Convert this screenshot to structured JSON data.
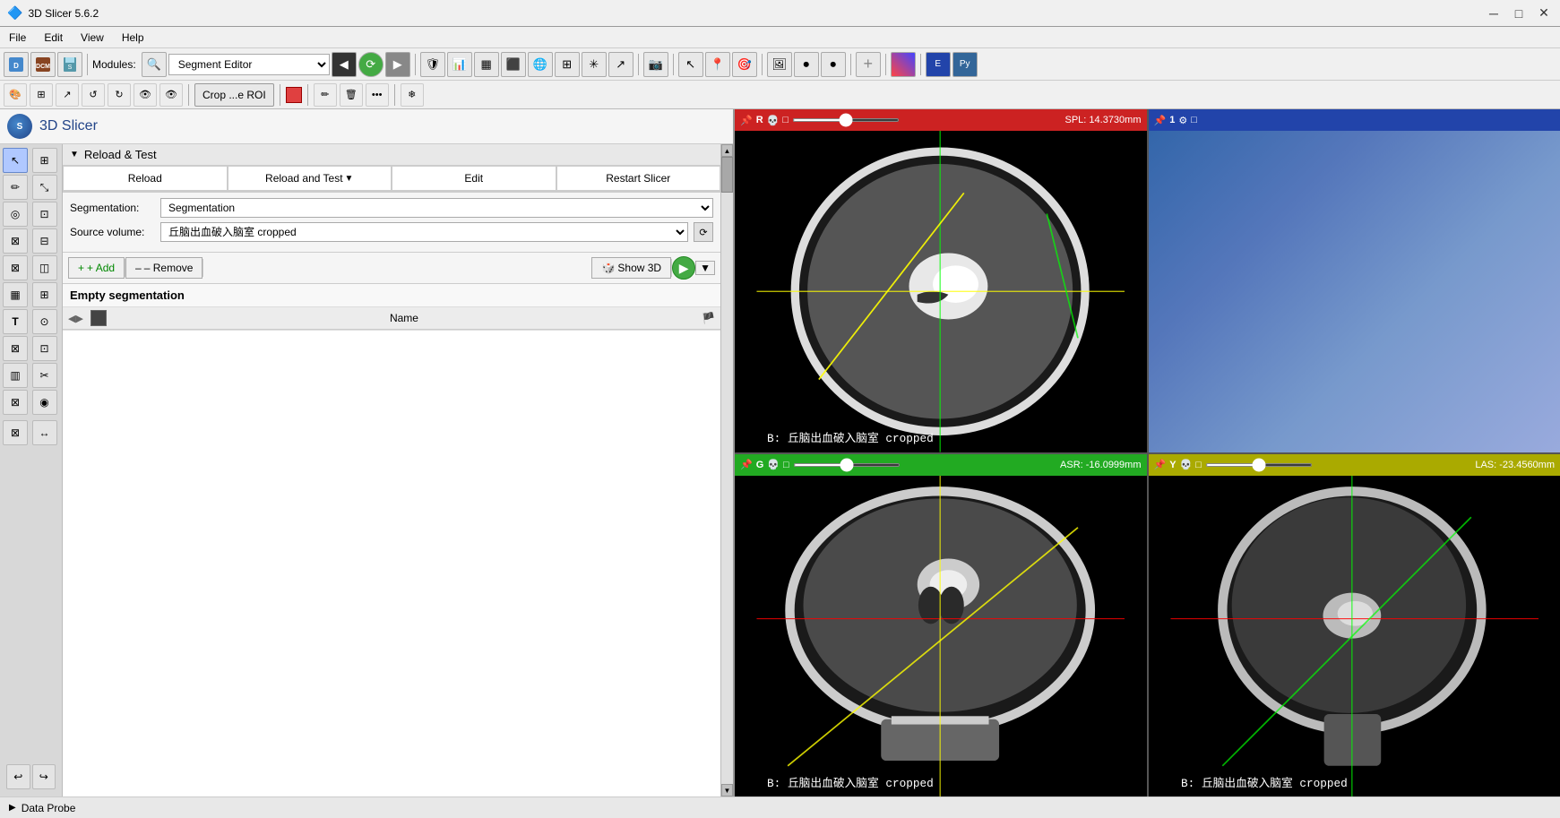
{
  "titleBar": {
    "title": "3D Slicer 5.6.2",
    "minimize": "─",
    "maximize": "□",
    "close": "✕"
  },
  "menuBar": {
    "items": [
      "File",
      "Edit",
      "View",
      "Help"
    ]
  },
  "toolbar1": {
    "modulesLabel": "Modules:",
    "selectedModule": "Segment Editor"
  },
  "toolbar2": {
    "cropLabel": "Crop ...e ROI"
  },
  "leftPanel": {
    "logo": "S",
    "title": "3D Slicer",
    "reloadTest": {
      "header": "Reload & Test",
      "buttons": [
        "Reload",
        "Reload and Test",
        "Edit",
        "Restart Slicer"
      ]
    },
    "segmentation": {
      "label": "Segmentation:",
      "value": "Segmentation"
    },
    "sourceVolume": {
      "label": "Source volume:",
      "value": "丘脑出血破入脑室 cropped"
    },
    "actions": {
      "add": "+ Add",
      "remove": "– Remove",
      "show3d": "Show 3D"
    },
    "emptySegmentation": {
      "header": "Empty segmentation",
      "columns": [
        "Name"
      ]
    }
  },
  "viewports": {
    "topLeft": {
      "label": "R",
      "type": "R",
      "coord": "SPL: 14.3730mm",
      "scanLabel": "B: 丘脑出血破入脑室 cropped"
    },
    "topRight": {
      "label": "1",
      "type": "1",
      "coord": ""
    },
    "bottomLeft": {
      "label": "G",
      "type": "G",
      "coord": "ASR: -16.0999mm",
      "scanLabel": "B: 丘脑出血破入脑室 cropped"
    },
    "bottomRight": {
      "label": "Y",
      "type": "Y",
      "coord": "LAS: -23.4560mm",
      "scanLabel": "B: 丘脑出血破入脑室 cropped"
    }
  },
  "dataProbe": {
    "label": "Data Probe"
  },
  "tools": {
    "topRow": [
      "↖",
      "⊞",
      "✏",
      "⤡",
      "◉",
      "⊡",
      "⊠",
      "⊟",
      "⊠",
      "◫",
      "⊠",
      "⊞",
      "T",
      "◎",
      "⊠",
      "⊡",
      "⊠",
      "✂",
      "⊠",
      "⊡"
    ],
    "undo": "↩",
    "redo": "↪"
  }
}
